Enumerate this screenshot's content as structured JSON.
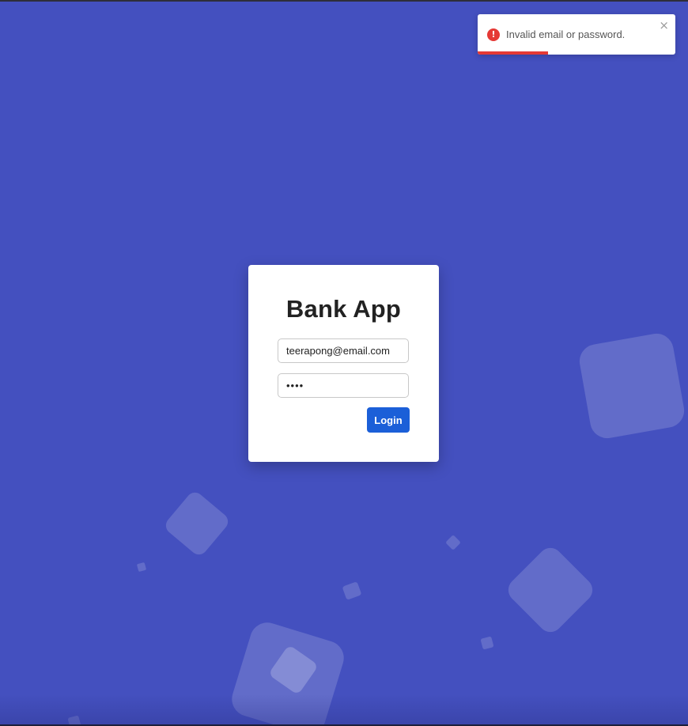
{
  "app": {
    "title": "Bank App"
  },
  "login": {
    "email_value": "teerapong@email.com",
    "password_value": "••••",
    "login_label": "Login"
  },
  "toast": {
    "message": "Invalid email or password.",
    "icon": "error-icon",
    "icon_glyph": "!",
    "close_glyph": "×",
    "progress_fraction": 0.355,
    "progress_color": "#e53935"
  },
  "colors": {
    "background": "#4450bf",
    "primary_button": "#1b5fd8",
    "error": "#e53935"
  }
}
